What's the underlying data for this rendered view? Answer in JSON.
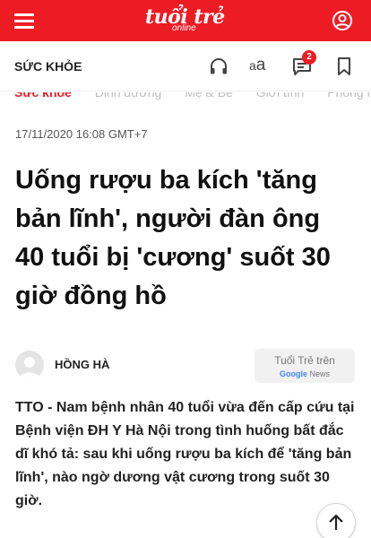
{
  "header": {
    "logo_text": "tuổi trẻ",
    "logo_sub": "online",
    "brand_color": "#ed1c24",
    "menu_icon": "hamburger-icon",
    "user_icon": "user-icon"
  },
  "subheader": {
    "section": "SỨC KHỎE",
    "font_size_label_small": "a",
    "font_size_label_large": "a",
    "comment_count": "2",
    "icons": [
      "headphone-icon",
      "font-size-icon",
      "comment-icon",
      "bookmark-icon"
    ]
  },
  "category_nav": [
    "Sức khỏe",
    "Dinh dưỡng",
    "Mẹ & Bé",
    "Giới tính",
    "Phòng mạch"
  ],
  "article": {
    "date": "17/11/2020 16:08 GMT+7",
    "title": "Uống rượu ba kích 'tăng bản lĩnh', người đàn ông 40 tuổi bị 'cương' suốt 30 giờ đồng hồ",
    "author": "HỒNG HÀ",
    "google_news_top": "Tuổi Trẻ trên",
    "google_news_g": "Google",
    "google_news_news": "News",
    "sapo": "TTO - Nam bệnh nhân 40 tuổi vừa đến cấp cứu tại Bệnh viện ĐH Y Hà Nội trong tình huống bất đắc dĩ khó tả: sau khi uống rượu ba kích để 'tăng bản lĩnh', nào ngờ dương vật cương trong suốt 30 giờ."
  },
  "scroll_top_icon": "arrow-up-icon"
}
